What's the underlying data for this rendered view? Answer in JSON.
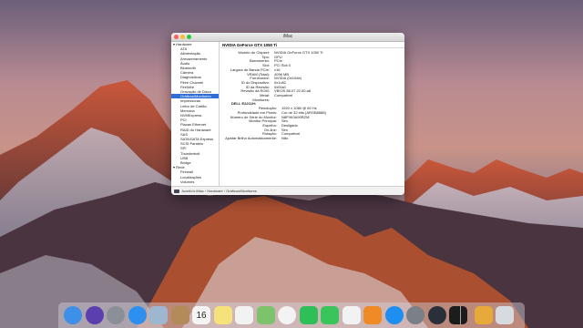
{
  "window": {
    "title": "iMac"
  },
  "sidebar": {
    "items": [
      {
        "label": "▾ Hardware",
        "kind": "grp"
      },
      {
        "label": "ATA",
        "kind": "sub"
      },
      {
        "label": "Alimentação",
        "kind": "sub"
      },
      {
        "label": "Armazenamento",
        "kind": "sub"
      },
      {
        "label": "Áudio",
        "kind": "sub"
      },
      {
        "label": "Bluetooth",
        "kind": "sub"
      },
      {
        "label": "Câmera",
        "kind": "sub"
      },
      {
        "label": "Diagnósticos",
        "kind": "sub"
      },
      {
        "label": "Fibre Channel",
        "kind": "sub"
      },
      {
        "label": "FireWire",
        "kind": "sub"
      },
      {
        "label": "Gravação de Disco",
        "kind": "sub"
      },
      {
        "label": "Gráficos/Monitores",
        "kind": "sub",
        "selected": true
      },
      {
        "label": "Impressoras",
        "kind": "sub"
      },
      {
        "label": "Leitor de Cartão",
        "kind": "sub"
      },
      {
        "label": "Memória",
        "kind": "sub"
      },
      {
        "label": "NVMExpress",
        "kind": "sub"
      },
      {
        "label": "PCI",
        "kind": "sub"
      },
      {
        "label": "Placas Ethernet",
        "kind": "sub"
      },
      {
        "label": "RAID do Hardware",
        "kind": "sub"
      },
      {
        "label": "SAS",
        "kind": "sub"
      },
      {
        "label": "SATA/SATA Express",
        "kind": "sub"
      },
      {
        "label": "SCSI Paralelo",
        "kind": "sub"
      },
      {
        "label": "SPI",
        "kind": "sub"
      },
      {
        "label": "Thunderbolt",
        "kind": "sub"
      },
      {
        "label": "USB",
        "kind": "sub"
      },
      {
        "label": "Bridge",
        "kind": "sub"
      },
      {
        "label": "▾ Rede",
        "kind": "grp"
      },
      {
        "label": "Firewall",
        "kind": "sub"
      },
      {
        "label": "Localizações",
        "kind": "sub"
      },
      {
        "label": "Volumes",
        "kind": "sub"
      }
    ]
  },
  "detail": {
    "header": "NVIDIA GeForce GTX 1050 Ti",
    "rows": [
      {
        "k": "Modelo do Chipset:",
        "v": "NVIDIA GeForce GTX 1050 Ti"
      },
      {
        "k": "Tipo:",
        "v": "GPU"
      },
      {
        "k": "Barramento:",
        "v": "PCIe"
      },
      {
        "k": "Slot:",
        "v": "PCI Slot 0"
      },
      {
        "k": "Largura de Banda PCIe:",
        "v": "x16"
      },
      {
        "k": "VRAM (Total):",
        "v": "4096 MB"
      },
      {
        "k": "Fornecedor:",
        "v": "NVIDIA (0x10de)"
      },
      {
        "k": "ID do Dispositivo:",
        "v": "0x1c82"
      },
      {
        "k": "ID da Revisão:",
        "v": "0x00a1"
      },
      {
        "k": "Revisão da ROM:",
        "v": "VBIOS 86.07.22.00.a8"
      },
      {
        "k": "Metal:",
        "v": "Compatível"
      },
      {
        "k": "Monitores:",
        "v": ""
      }
    ],
    "monitor_name": "DELL E2211H:",
    "monitor_rows": [
      {
        "k": "Resolução:",
        "v": "1920 x 1080 @ 60 Hz"
      },
      {
        "k": "Profundidade em Pixels:",
        "v": "Cor de 32 bits (ARGB8888)"
      },
      {
        "k": "Número de Série do Monitor:",
        "v": "N8F9K0A90RZM"
      },
      {
        "k": "Monitor Principal:",
        "v": "Sim"
      },
      {
        "k": "Espelho:",
        "v": "Desligado"
      },
      {
        "k": "On-line:",
        "v": "Sim"
      },
      {
        "k": "Rotação:",
        "v": "Compatível"
      },
      {
        "k": "Ajustar Brilho Automaticamente:",
        "v": "Não"
      }
    ]
  },
  "pathbar": {
    "text": "Jocelio's iMac › Hardware › Gráficos/Monitores"
  },
  "dock": {
    "icons": [
      {
        "name": "finder-icon",
        "color": "#3d8fe8"
      },
      {
        "name": "siri-icon",
        "color": "#5b3fae"
      },
      {
        "name": "launchpad-icon",
        "color": "#8a8f98"
      },
      {
        "name": "safari-icon",
        "color": "#2d8ff0"
      },
      {
        "name": "mail-icon",
        "color": "#9fb6d0"
      },
      {
        "name": "contacts-icon",
        "color": "#b38a5a"
      },
      {
        "name": "calendar-icon",
        "color": "#f4f4f4"
      },
      {
        "name": "notes-icon",
        "color": "#f5e27a"
      },
      {
        "name": "reminders-icon",
        "color": "#f2f2f2"
      },
      {
        "name": "maps-icon",
        "color": "#7cc36b"
      },
      {
        "name": "photos-icon",
        "color": "#f3f3f3"
      },
      {
        "name": "messages-icon",
        "color": "#2fbf59"
      },
      {
        "name": "facetime-icon",
        "color": "#3ac55c"
      },
      {
        "name": "itunes-icon",
        "color": "#f2f2f2"
      },
      {
        "name": "ibooks-icon",
        "color": "#f08a24"
      },
      {
        "name": "app-store-icon",
        "color": "#1f8ef1"
      },
      {
        "name": "system-preferences-icon",
        "color": "#7b7f87"
      },
      {
        "name": "quicktime-icon",
        "color": "#2a2f3a"
      },
      {
        "name": "terminal-icon",
        "color": "#1c1c1c"
      },
      {
        "name": "downloads-icon",
        "color": "#e6a93a"
      },
      {
        "name": "trash-icon",
        "color": "#d7dade"
      }
    ]
  },
  "calendar_day": "16"
}
